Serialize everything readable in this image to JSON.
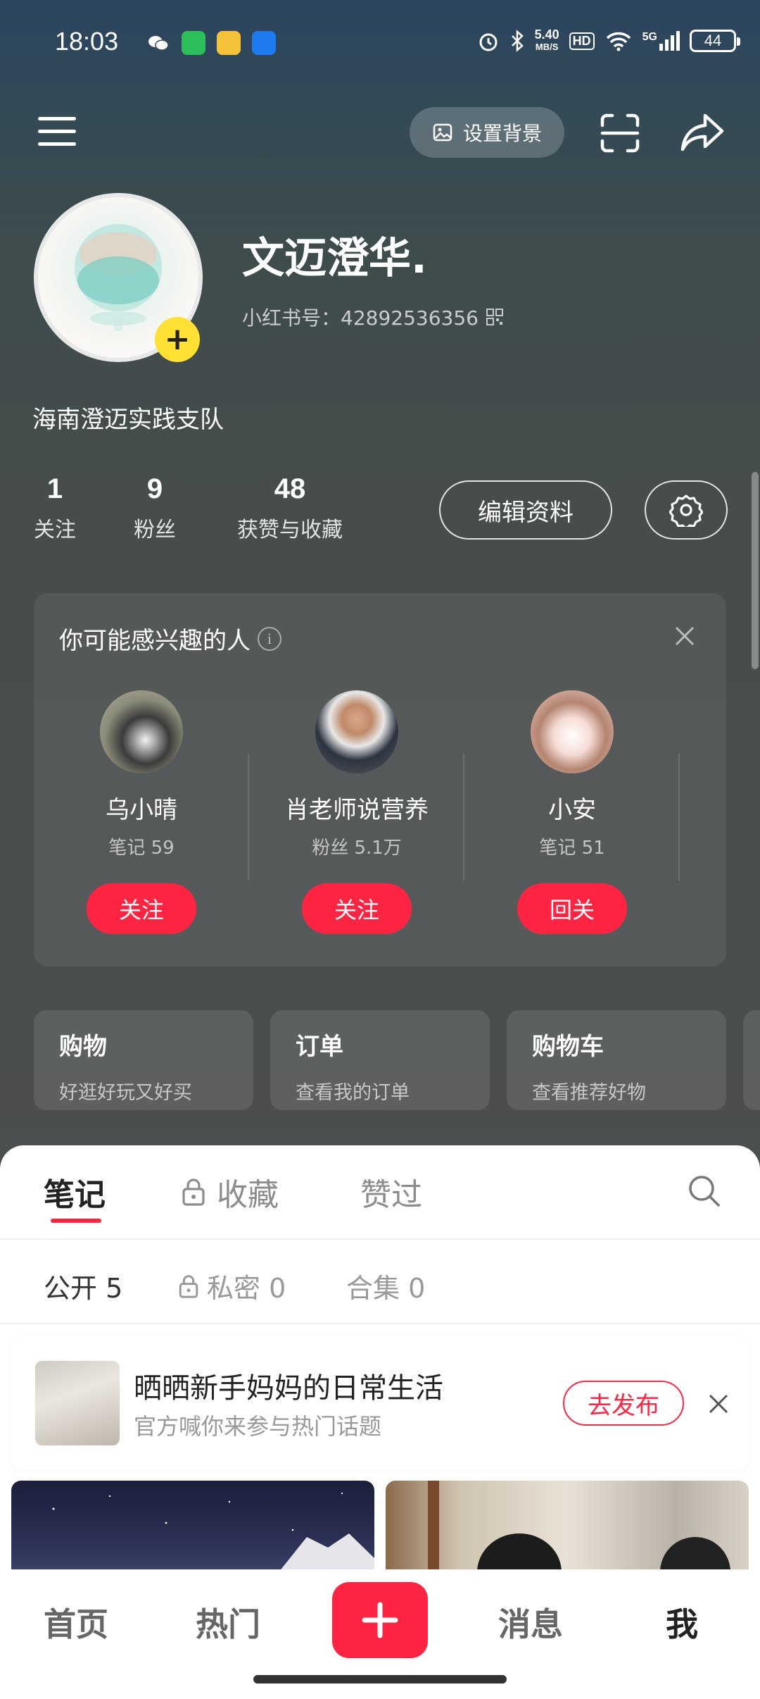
{
  "status_bar": {
    "time": "18:03",
    "net_speed_top": "5.40",
    "net_speed_unit": "MB/S",
    "hd": "HD",
    "signal": "5G",
    "battery": "44"
  },
  "top_bar": {
    "set_background_label": "设置背景"
  },
  "profile": {
    "nickname": "文迈澄华.",
    "redbook_id_label": "小红书号：42892536356",
    "bio": "海南澄迈实践支队",
    "stats": [
      {
        "num": "1",
        "label": "关注"
      },
      {
        "num": "9",
        "label": "粉丝"
      },
      {
        "num": "48",
        "label": "获赞与收藏"
      }
    ],
    "edit_label": "编辑资料"
  },
  "suggest": {
    "title": "你可能感兴趣的人",
    "people": [
      {
        "name": "乌小晴",
        "sub": "笔记 59",
        "btn": "关注"
      },
      {
        "name": "肖老师说营养",
        "sub": "粉丝 5.1万",
        "btn": "关注"
      },
      {
        "name": "小安",
        "sub": "笔记 51",
        "btn": "回关"
      }
    ]
  },
  "shortcuts": [
    {
      "title": "购物",
      "sub": "好逛好玩又好买"
    },
    {
      "title": "订单",
      "sub": "查看我的订单"
    },
    {
      "title": "购物车",
      "sub": "查看推荐好物"
    }
  ],
  "tabs": [
    "笔记",
    "收藏",
    "赞过"
  ],
  "subtabs": [
    "公开 5",
    "私密 0",
    "合集 0"
  ],
  "topic": {
    "title": "晒晒新手妈妈的日常生活",
    "sub": "官方喊你来参与热门话题",
    "btn": "去发布"
  },
  "bottom_nav": {
    "home": "首页",
    "hot": "热门",
    "messages": "消息",
    "me": "我"
  },
  "colors": {
    "accent": "#ff2442",
    "yellow": "#ffe033"
  }
}
